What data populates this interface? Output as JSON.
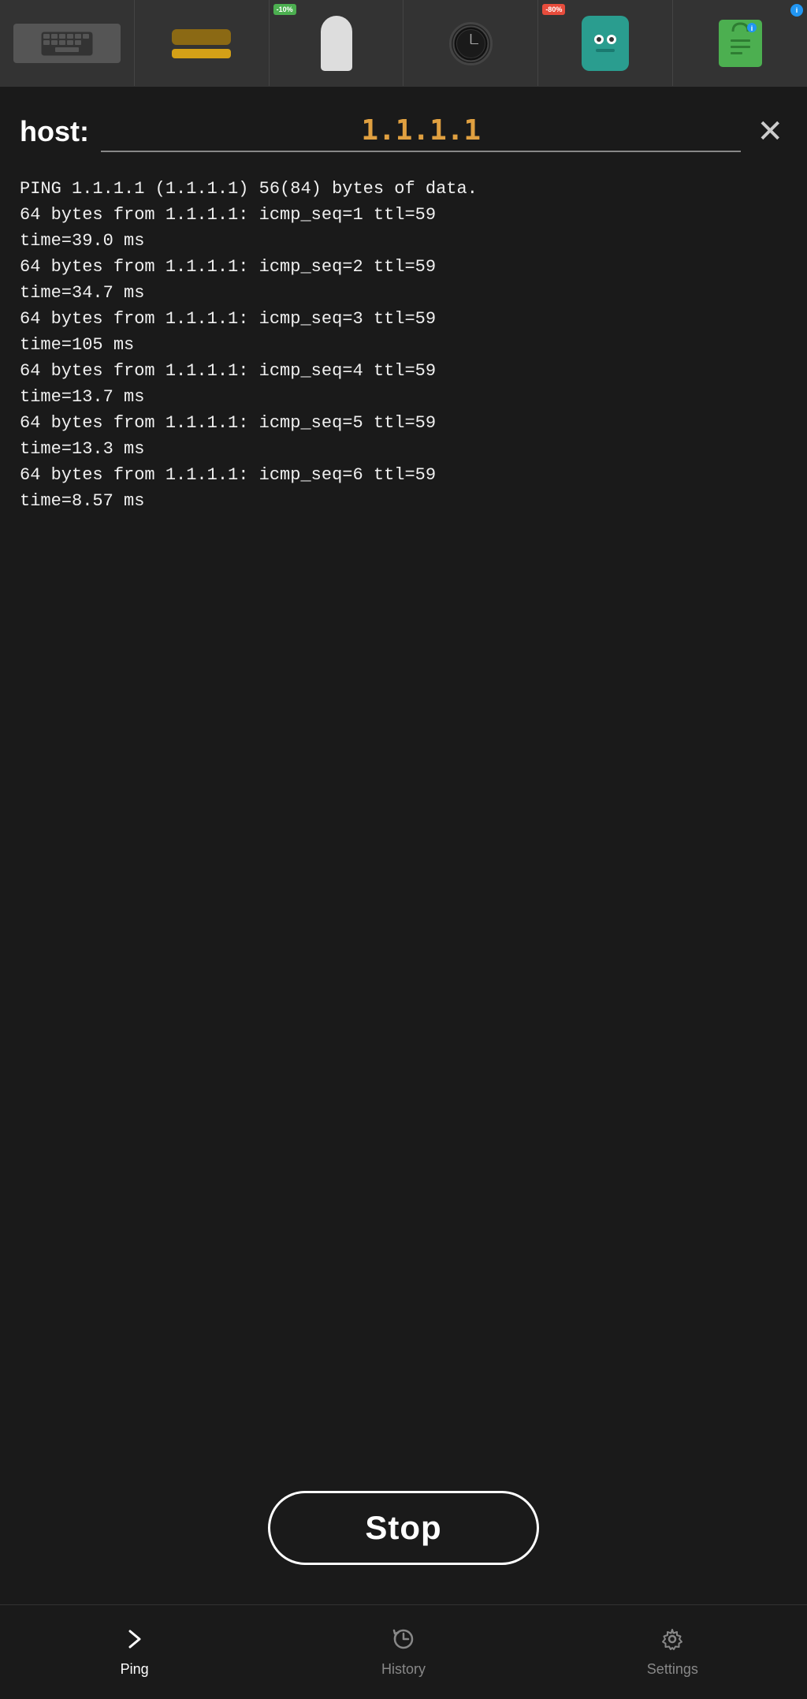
{
  "ad_banner": {
    "items": [
      {
        "id": "keyboard",
        "type": "keyboard",
        "alt": "Keyboard product"
      },
      {
        "id": "wrist-rest",
        "type": "wrist-rest",
        "alt": "Wrist rest product"
      },
      {
        "id": "humidifier",
        "type": "humidifier",
        "alt": "Humidifier product",
        "badge": "-10%",
        "badge_color": "green"
      },
      {
        "id": "watch",
        "type": "watch",
        "alt": "Watch product"
      },
      {
        "id": "robot",
        "type": "robot",
        "alt": "Robot toy product",
        "badge": "-80%",
        "badge_color": "red"
      },
      {
        "id": "shopping-bag",
        "type": "shopping-bag",
        "alt": "Shopping bag product",
        "badge": "i",
        "badge_color": "blue"
      }
    ]
  },
  "header": {
    "host_label": "host:",
    "host_value": "1.1.1.1",
    "close_label": "✕"
  },
  "terminal": {
    "output": "PING 1.1.1.1 (1.1.1.1) 56(84) bytes of data.\n64 bytes from 1.1.1.1: icmp_seq=1 ttl=59\ntime=39.0 ms\n64 bytes from 1.1.1.1: icmp_seq=2 ttl=59\ntime=34.7 ms\n64 bytes from 1.1.1.1: icmp_seq=3 ttl=59\ntime=105 ms\n64 bytes from 1.1.1.1: icmp_seq=4 ttl=59\ntime=13.7 ms\n64 bytes from 1.1.1.1: icmp_seq=5 ttl=59\ntime=13.3 ms\n64 bytes from 1.1.1.1: icmp_seq=6 ttl=59\ntime=8.57 ms"
  },
  "stop_button": {
    "label": "Stop"
  },
  "bottom_nav": {
    "items": [
      {
        "id": "ping",
        "label": "Ping",
        "icon": "chevron-right",
        "active": true
      },
      {
        "id": "history",
        "label": "History",
        "icon": "history",
        "active": false
      },
      {
        "id": "settings",
        "label": "Settings",
        "icon": "gear",
        "active": false
      }
    ]
  }
}
